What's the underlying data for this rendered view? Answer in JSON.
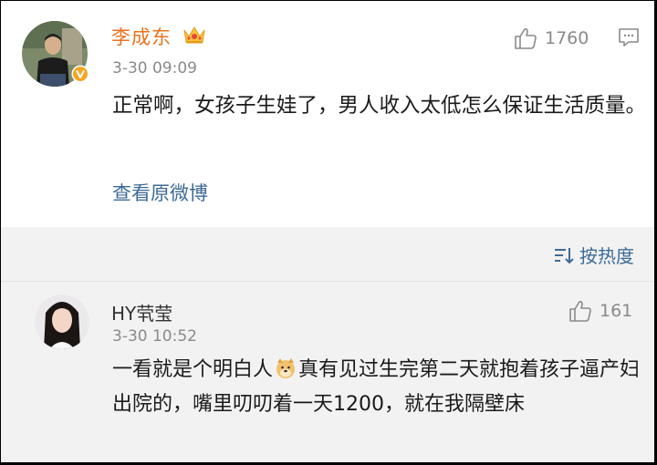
{
  "post": {
    "username": "李成东",
    "badge_icon": "crown-icon",
    "verified_icon": "verified-v-icon",
    "timestamp": "3-30 09:09",
    "like_count": "1760",
    "content": "正常啊，女孩子生娃了，男人收入太低怎么保证生活质量。",
    "view_original_label": "查看原微博"
  },
  "sort": {
    "label": "按热度",
    "icon": "sort-icon"
  },
  "reply": {
    "username": "HY茕莹",
    "timestamp": "3-30 10:52",
    "like_count": "161",
    "content_before_emoji": "一看就是个明白人",
    "emoji": "doge-emoji",
    "content_after_emoji": "真有见过生完第二天就抱着孩子逼产妇出院的，嘴里叨叨着一天1200，就在我隔壁床"
  },
  "colors": {
    "username_orange": "#e8731e",
    "link_blue": "#3d6a96",
    "meta_gray": "#8a8a8a",
    "background_gray": "#f2f2f2"
  }
}
